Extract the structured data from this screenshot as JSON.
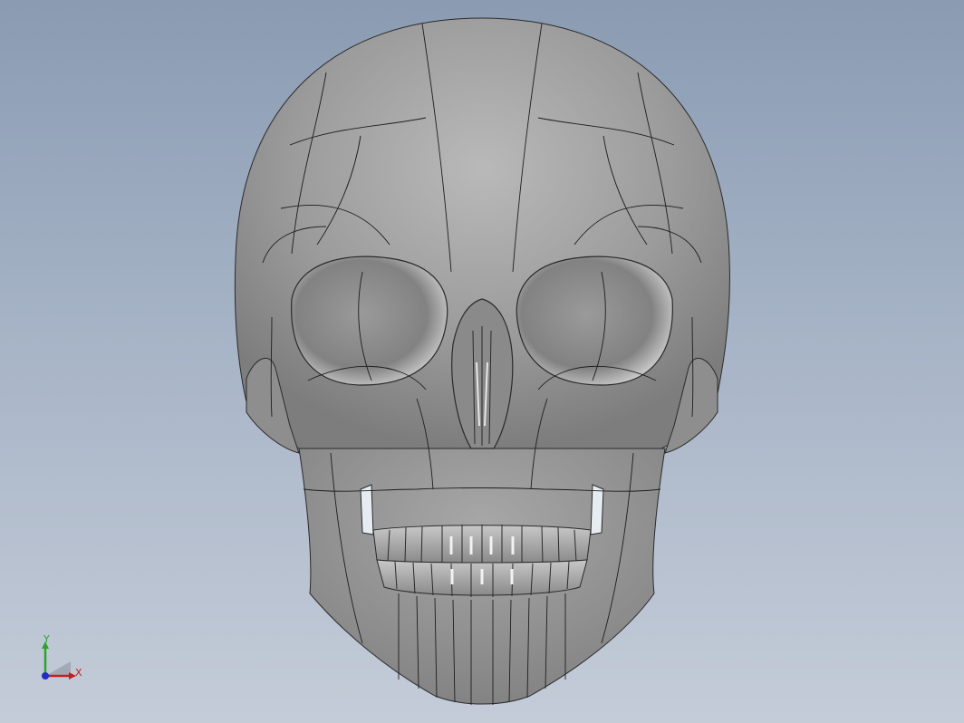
{
  "viewport": {
    "model": "skull",
    "background_top": "#8a9bb2",
    "background_bottom": "#c4ccd8",
    "shading": "shaded-with-edges"
  },
  "triad": {
    "y_label": "Y",
    "x_label": "X",
    "y_color": "#2aa52a",
    "x_color": "#c21f1f",
    "z_color": "#1f2fc2"
  }
}
